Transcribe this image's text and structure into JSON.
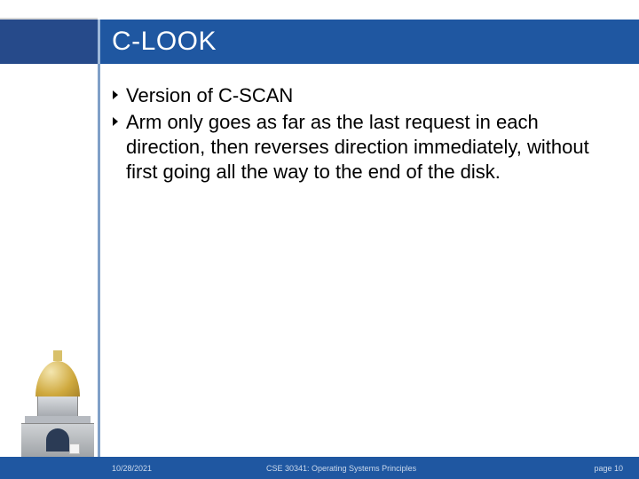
{
  "title": "C-LOOK",
  "bullets": [
    "Version of C-SCAN",
    "Arm only goes as far as the last request in each direction, then reverses direction immediately, without first going all the way to the end of the disk."
  ],
  "footer": {
    "date": "10/28/2021",
    "course": "CSE 30341: Operating Systems Principles",
    "page": "page 10"
  },
  "colors": {
    "brand_blue": "#1F57A1",
    "brand_blue_dark": "#264A8A"
  },
  "icons": {
    "bullet": "chevron-right-icon",
    "logo": "dome-building-icon"
  }
}
